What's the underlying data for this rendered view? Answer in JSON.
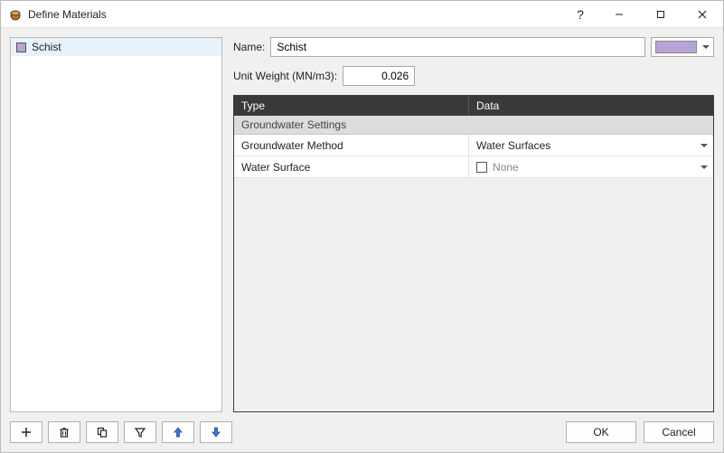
{
  "titlebar": {
    "title": "Define Materials"
  },
  "materials": {
    "items": [
      {
        "name": "Schist",
        "color": "#b7a3d6"
      }
    ]
  },
  "form": {
    "name_label": "Name:",
    "name_value": "Schist",
    "unit_weight_label": "Unit Weight (MN/m3):",
    "unit_weight_value": "0.026",
    "color_value": "#b7a3d6"
  },
  "table": {
    "headers": {
      "type": "Type",
      "data": "Data"
    },
    "group_label": "Groundwater Settings",
    "rows": [
      {
        "type": "Groundwater Method",
        "data": "Water Surfaces",
        "kind": "dropdown"
      },
      {
        "type": "Water Surface",
        "data": "None",
        "kind": "check-dropdown"
      }
    ]
  },
  "buttons": {
    "ok": "OK",
    "cancel": "Cancel"
  },
  "toolbar": {
    "add": "add",
    "delete": "delete",
    "copy": "copy",
    "filter": "filter",
    "move_up": "move-up",
    "move_down": "move-down"
  }
}
